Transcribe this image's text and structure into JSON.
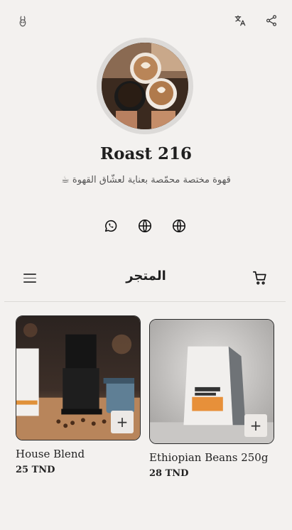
{
  "header": {
    "logo_icon": "rabbit-icon",
    "translate_icon": "translate-icon",
    "share_icon": "share-icon"
  },
  "profile": {
    "name": "Roast 216",
    "tagline": "قهوة مختصة محمّصة بعناية لعشّاق القهوة ☕"
  },
  "social_links": [
    {
      "icon": "whatsapp-icon"
    },
    {
      "icon": "globe-icon"
    },
    {
      "icon": "globe-icon"
    }
  ],
  "store": {
    "title": "المتجر",
    "menu_icon": "hamburger-menu-icon",
    "cart_icon": "shopping-cart-icon"
  },
  "products": [
    {
      "name": "House Blend",
      "price": "25 TND",
      "add_label": "+"
    },
    {
      "name": "Ethiopian Beans 250g",
      "price": "28 TND",
      "add_label": "+"
    }
  ],
  "colors": {
    "background": "#f3f1ef",
    "text": "#222222",
    "divider": "#dcdad7"
  }
}
